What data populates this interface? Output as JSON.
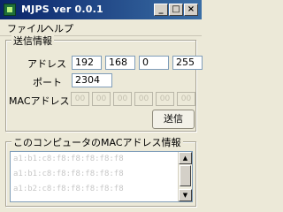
{
  "window": {
    "title": "MJPS ver 0.0.1",
    "controls": {
      "minimize": "_",
      "maximize": "□",
      "close": "×"
    },
    "icon": "app-icon"
  },
  "menu": {
    "file": "ファイル",
    "help": "ヘルプ"
  },
  "send_group": {
    "title": "送信情報",
    "address_label": "アドレス",
    "ip": [
      "192",
      "168",
      "0",
      "255"
    ],
    "port_label": "ポート",
    "port": "2304",
    "mac_label": "MACアドレス",
    "mac_placeholders": [
      "00",
      "00",
      "00",
      "00",
      "00",
      "00"
    ],
    "send_button": "送信"
  },
  "mac_group": {
    "title": "このコンピュータのMACアドレス情報",
    "rows": [
      "a1:b1:c8:f8:f8:f8:f8:f8",
      "a1:b1:c8:f8:f8:f8:f8:f8",
      "a1:b2:c8:f8:f8:f8:f8:f8"
    ]
  }
}
